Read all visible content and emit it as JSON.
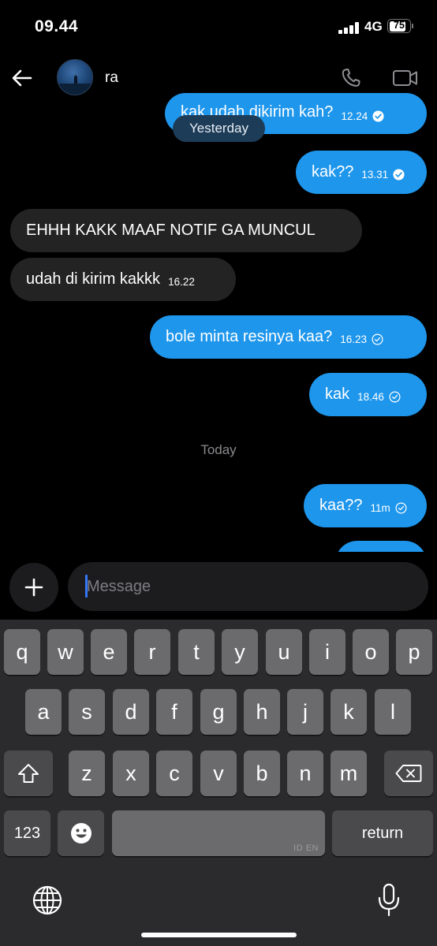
{
  "status_bar": {
    "time": "09.44",
    "network": "4G",
    "battery": "75"
  },
  "header": {
    "contact_name": "ra"
  },
  "messages": [
    {
      "text": "kak udah dikirim kah?",
      "time": "12.24"
    },
    {
      "text": "kak??",
      "time": "13.31"
    },
    {
      "text": "EHHH KAKK MAAF NOTIF GA MUNCUL",
      "time": ""
    },
    {
      "text": "udah di kirim kakkk",
      "time": "16.22"
    },
    {
      "text": "bole minta resinya kaa?",
      "time": "16.23"
    },
    {
      "text": "kak",
      "time": "18.46"
    },
    {
      "text": "kaa??",
      "time": "11m"
    }
  ],
  "day_separators": {
    "yesterday": "Yesterday",
    "today": "Today"
  },
  "composer": {
    "placeholder": "Message"
  },
  "keyboard": {
    "row1": [
      "q",
      "w",
      "e",
      "r",
      "t",
      "y",
      "u",
      "i",
      "o",
      "p"
    ],
    "row2": [
      "a",
      "s",
      "d",
      "f",
      "g",
      "h",
      "j",
      "k",
      "l"
    ],
    "row3": [
      "z",
      "x",
      "c",
      "v",
      "b",
      "n",
      "m"
    ],
    "numbers_label": "123",
    "return_label": "return",
    "space_lang_label": "ID EN"
  },
  "colors": {
    "outgoing_bubble": "#1e96ec",
    "incoming_bubble": "#232324",
    "day_pill": "#1d3c57",
    "keyboard_bg": "#2b2b2d"
  }
}
